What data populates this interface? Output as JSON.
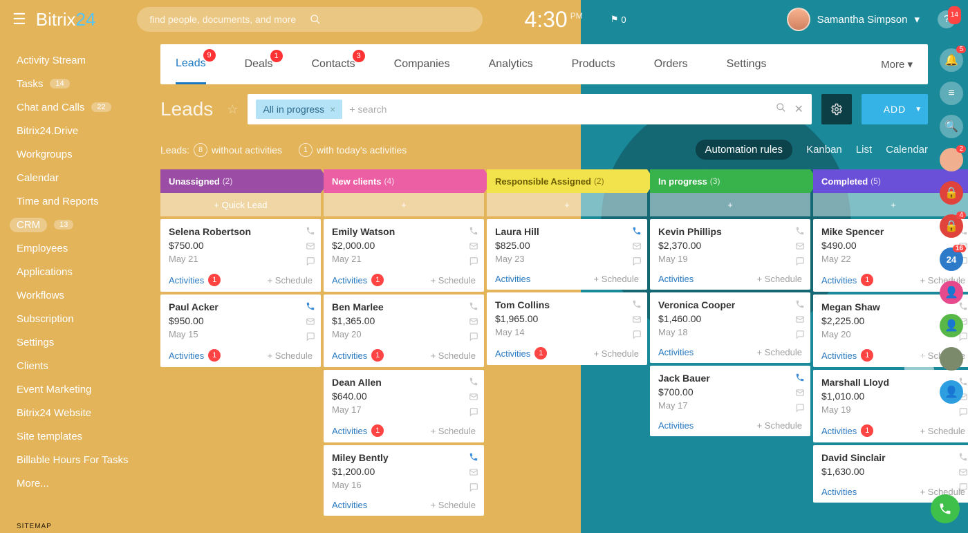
{
  "logo": {
    "p1": "Bitrix",
    "p2": "24"
  },
  "search_placeholder": "find people, documents, and more",
  "clock": {
    "time": "4:30",
    "ampm": "PM"
  },
  "flag_count": "0",
  "user_name": "Samantha Simpson",
  "help_badge": "14",
  "leftnav": [
    {
      "label": "Activity Stream"
    },
    {
      "label": "Tasks",
      "pill": "14"
    },
    {
      "label": "Chat and Calls",
      "pill": "22"
    },
    {
      "label": "Bitrix24.Drive"
    },
    {
      "label": "Workgroups"
    },
    {
      "label": "Calendar"
    },
    {
      "label": "Time and Reports"
    },
    {
      "label": "CRM",
      "pill": "13",
      "selected": true
    },
    {
      "label": "Employees"
    },
    {
      "label": "Applications"
    },
    {
      "label": "Workflows"
    },
    {
      "label": "Subscription"
    },
    {
      "label": "Settings"
    },
    {
      "label": "Clients"
    },
    {
      "label": "Event Marketing"
    },
    {
      "label": "Bitrix24 Website"
    },
    {
      "label": "Site templates"
    },
    {
      "label": "Billable Hours For Tasks"
    },
    {
      "label": "More..."
    }
  ],
  "sitemap": "SITEMAP",
  "tabs": [
    {
      "label": "Leads",
      "badge": "9",
      "active": true
    },
    {
      "label": "Deals",
      "badge": "1"
    },
    {
      "label": "Contacts",
      "badge": "3"
    },
    {
      "label": "Companies"
    },
    {
      "label": "Analytics"
    },
    {
      "label": "Products"
    },
    {
      "label": "Orders"
    },
    {
      "label": "Settings"
    }
  ],
  "tabs_more": "More",
  "page_title": "Leads",
  "filter_chip": "All in progress",
  "filter_placeholder": "+ search",
  "add_label": "ADD",
  "stats": {
    "leads_label": "Leads:",
    "leads_n": "8",
    "without": "without activities",
    "today_n": "1",
    "today": "with today's activities"
  },
  "views": {
    "auto": "Automation rules",
    "kanban": "Kanban",
    "list": "List",
    "calendar": "Calendar"
  },
  "quick_lead": "+   Quick Lead",
  "plus": "+",
  "activities_label": "Activities",
  "schedule_label": "+ Schedule",
  "columns": [
    {
      "title": "Unassigned",
      "count": "(2)",
      "color": "#9b4da6",
      "quick": true,
      "cards": [
        {
          "name": "Selena Robertson",
          "amount": "$750.00",
          "date": "May 21",
          "ab": "1"
        },
        {
          "name": "Paul Acker",
          "amount": "$950.00",
          "date": "May 15",
          "ab": "1",
          "phone": true
        }
      ]
    },
    {
      "title": "New clients",
      "count": "(4)",
      "color": "#ed5fa5",
      "quick": false,
      "cards": [
        {
          "name": "Emily Watson",
          "amount": "$2,000.00",
          "date": "May 21",
          "ab": "1"
        },
        {
          "name": "Ben Marlee",
          "amount": "$1,365.00",
          "date": "May 20",
          "ab": "1"
        },
        {
          "name": "Dean Allen",
          "amount": "$640.00",
          "date": "May 17",
          "ab": "1"
        },
        {
          "name": "Miley Bently",
          "amount": "$1,200.00",
          "date": "May 16",
          "phone": true
        }
      ]
    },
    {
      "title": "Responsible Assigned",
      "count": "(2)",
      "color": "#f2e24b",
      "text": "#6b5b00",
      "quick": false,
      "cards": [
        {
          "name": "Laura Hill",
          "amount": "$825.00",
          "date": "May 23",
          "phone": true
        },
        {
          "name": "Tom Collins",
          "amount": "$1,965.00",
          "date": "May 14",
          "ab": "1"
        }
      ]
    },
    {
      "title": "In progress",
      "count": "(3)",
      "color": "#38b24a",
      "quick": false,
      "cards": [
        {
          "name": "Kevin Phillips",
          "amount": "$2,370.00",
          "date": "May 19"
        },
        {
          "name": "Veronica Cooper",
          "amount": "$1,460.00",
          "date": "May 18"
        },
        {
          "name": "Jack Bauer",
          "amount": "$700.00",
          "date": "May 17",
          "phone": true
        }
      ]
    },
    {
      "title": "Completed",
      "count": "(5)",
      "color": "#6a4fd8",
      "quick": false,
      "cards": [
        {
          "name": "Mike Spencer",
          "amount": "$490.00",
          "date": "May 22",
          "ab": "1"
        },
        {
          "name": "Megan Shaw",
          "amount": "$2,225.00",
          "date": "May 20",
          "ab": "1"
        },
        {
          "name": "Marshall Lloyd",
          "amount": "$1,010.00",
          "date": "May 19",
          "ab": "1"
        },
        {
          "name": "David Sinclair",
          "amount": "$1,630.00",
          "date": ""
        }
      ]
    }
  ],
  "rail": [
    {
      "icon": "bell",
      "bg": "rgba(255,255,255,.3)",
      "badge": "5"
    },
    {
      "icon": "lines",
      "bg": "rgba(255,255,255,.3)"
    },
    {
      "icon": "search",
      "bg": "rgba(255,255,255,.3)"
    },
    {
      "icon": "avatar",
      "bg": "#f0b090",
      "badge": "2"
    },
    {
      "icon": "lock",
      "bg": "#e0423c"
    },
    {
      "icon": "lock",
      "bg": "#e0423c",
      "badge": "4"
    },
    {
      "icon": "24",
      "bg": "#2d7ac9",
      "badge": "16"
    },
    {
      "icon": "person",
      "bg": "#e64a8d"
    },
    {
      "icon": "person",
      "bg": "#57b847"
    },
    {
      "icon": "avatar",
      "bg": "#7a8a6a"
    },
    {
      "icon": "person",
      "bg": "#2d9fe0"
    }
  ]
}
